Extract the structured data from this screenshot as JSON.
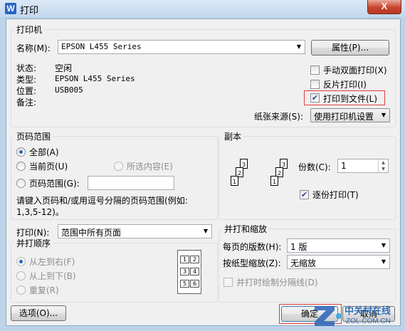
{
  "window": {
    "app_icon": "W",
    "title": "打印",
    "close_label": "X"
  },
  "printer": {
    "legend": "打印机",
    "name_label": "名称(M):",
    "name_value": "EPSON L455 Series",
    "properties_button": "属性(P)...",
    "status_label": "状态:",
    "status_value": "空闲",
    "type_label": "类型:",
    "type_value": "EPSON L455 Series",
    "location_label": "位置:",
    "location_value": "USB005",
    "comment_label": "备注:",
    "manual_duplex_label": "手动双面打印(X)",
    "reverse_label": "反片打印(I)",
    "print_to_file_label": "打印到文件(L)",
    "paper_source_label": "纸张来源(S):",
    "paper_source_value": "使用打印机设置"
  },
  "page_range": {
    "legend": "页码范围",
    "all_label": "全部(A)",
    "current_label": "当前页(U)",
    "selection_label": "所选内容(E)",
    "pages_label": "页码范围(G):",
    "pages_value": "",
    "hint_line1": "请键入页码和/或用逗号分隔的页码范围(例如:",
    "hint_line2": "1,3,5-12)。"
  },
  "copies": {
    "legend": "副本",
    "count_label": "份数(C):",
    "count_value": "1",
    "collate_label": "逐份打印(T)",
    "page_numbers": [
      "1",
      "2",
      "3"
    ]
  },
  "print_what": {
    "label": "打印(N):",
    "value": "范围中所有页面"
  },
  "order": {
    "legend": "并打顺序",
    "left_right_label": "从左到右(F)",
    "top_bottom_label": "从上到下(B)",
    "repeat_label": "重复(R)",
    "preview_cells": [
      "1",
      "2",
      "3",
      "4",
      "5",
      "6"
    ]
  },
  "zoom": {
    "legend": "并打和缩放",
    "pages_per_sheet_label": "每页的版数(H):",
    "pages_per_sheet_value": "1 版",
    "scale_label": "按纸型缩放(Z):",
    "scale_value": "无缩放",
    "draw_separator_label": "并打时绘制分隔线(D)"
  },
  "footer": {
    "options_button": "选项(O)...",
    "ok_button": "确定",
    "cancel_button": "取消"
  },
  "watermark": {
    "text_top": "中关村在线",
    "text_bottom": "ZOL.COM.CN"
  },
  "colors": {
    "highlight": "#e43c3c",
    "accent": "#2a63b7"
  }
}
